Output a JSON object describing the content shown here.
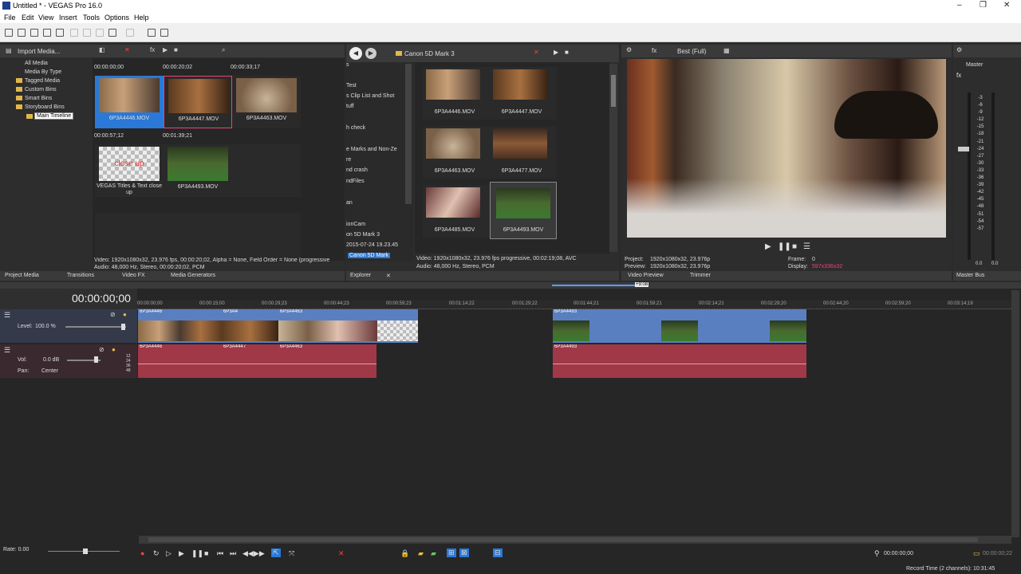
{
  "window": {
    "title": "Untitled * - VEGAS Pro 16.0",
    "controls": [
      "–",
      "❐",
      "✕"
    ]
  },
  "menu": [
    "File",
    "Edit",
    "View",
    "Insert",
    "Tools",
    "Options",
    "Help"
  ],
  "project_media": {
    "toolbar_label": "Import Media...",
    "tree": [
      "All Media",
      "Media By Type",
      "Tagged Media",
      "Custom Bins",
      "Smart Bins",
      "Storyboard Bins",
      "Main Timeline"
    ],
    "row1_times": [
      "00:00:00;00",
      "00:00:20;02",
      "00:00:33;17"
    ],
    "row1_clips": [
      "6P3A4446.MOV",
      "6P3A4447.MOV",
      "6P3A4463.MOV"
    ],
    "row2_times": [
      "00:00:57;12",
      "00:01:39;21"
    ],
    "row2_clips": [
      "VEGAS Titles & Text close up",
      "6P3A4493.MOV"
    ],
    "title_card_text": "close up",
    "info_line1": "Video: 1920x1080x32, 23.976 fps, 00:00:20;02, Alpha = None, Field Order = None (progressive",
    "info_line2": "Audio: 48,000 Hz, Stereo, 00:00:20;02, PCM",
    "tabs": [
      "Project Media",
      "Transitions",
      "Video FX",
      "Media Generators"
    ]
  },
  "explorer": {
    "path": "Canon 5D Mark 3",
    "tree": [
      "s",
      "Test",
      "s Clip List and Shot",
      "tuff",
      "",
      "h check",
      "",
      "e Marks and Non-Ze",
      "re",
      "nd crash",
      "ndFiles",
      "",
      "an",
      "",
      "ionCam",
      "on 5D Mark 3",
      "2015-07-24 19.23.45",
      "Canon 5D Mark"
    ],
    "files": [
      "6P3A4446.MOV",
      "6P3A4447.MOV",
      "6P3A4463.MOV",
      "6P3A4477.MOV",
      "6P3A4485.MOV",
      "6P3A4493.MOV"
    ],
    "info_line1": "Video: 1920x1080x32, 23.976 fps progressive, 00:02:19;08, AVC",
    "info_line2": "Audio: 48,000 Hz, Stereo, PCM",
    "tab": "Explorer"
  },
  "preview": {
    "quality": "Best (Full)",
    "project_label": "Project:",
    "project_value": "1920x1080x32, 23.976p",
    "preview_label": "Preview:",
    "preview_value": "1920x1080x32, 23.976p",
    "frame_label": "Frame:",
    "frame_value": "0",
    "display_label": "Display:",
    "display_value": "597x336x32",
    "tabs": [
      "Video Preview",
      "Trimmer"
    ]
  },
  "master": {
    "label": "Master",
    "scale": [
      "-3",
      "-6",
      "-9",
      "-12",
      "-15",
      "-18",
      "-21",
      "-24",
      "-27",
      "-30",
      "-33",
      "-36",
      "-39",
      "-42",
      "-45",
      "-48",
      "-51",
      "-54",
      "-57"
    ],
    "readout": [
      "0.0",
      "0.0"
    ],
    "tab": "Master Bus"
  },
  "timeline": {
    "cursor_time": "00:00:00;00",
    "ruler": [
      "00:00:00;00",
      "00:00:15;00",
      "00:00:29;23",
      "00:00:44;23",
      "00:00:59;23",
      "00:01:14;22",
      "00:01:29;22",
      "00:01:44;21",
      "00:01:59;21",
      "00:02:14;21",
      "00:02:29;20",
      "00:02:44;20",
      "00:02:59;20",
      "00:03:14;19"
    ],
    "marker": "+9:08",
    "video_track": {
      "level_label": "Level:",
      "level_value": "100.0 %"
    },
    "audio_track": {
      "vol_label": "Vol:",
      "vol_value": "0.0 dB",
      "pan_label": "Pan:",
      "pan_value": "Center",
      "meter": [
        "12",
        "24",
        "36",
        "48"
      ]
    },
    "video_clips": [
      "6P3A4446",
      "6P3A4",
      "6P3A4463",
      "6P3A4493"
    ],
    "audio_clips": [
      "6P3A4446",
      "6P3A4447",
      "6P3A4463",
      "6P3A4493"
    ],
    "rate_label": "Rate: 0.00",
    "transport_time": "00:00:00;00",
    "end_time": "00:00:00;22",
    "record_time": "Record Time (2 channels): 10:31:45"
  },
  "colors": {
    "video_clip": "#5a7fc0",
    "audio_clip": "#a03848",
    "selection": "#2a78d8",
    "accent_pink": "#e8457a"
  }
}
